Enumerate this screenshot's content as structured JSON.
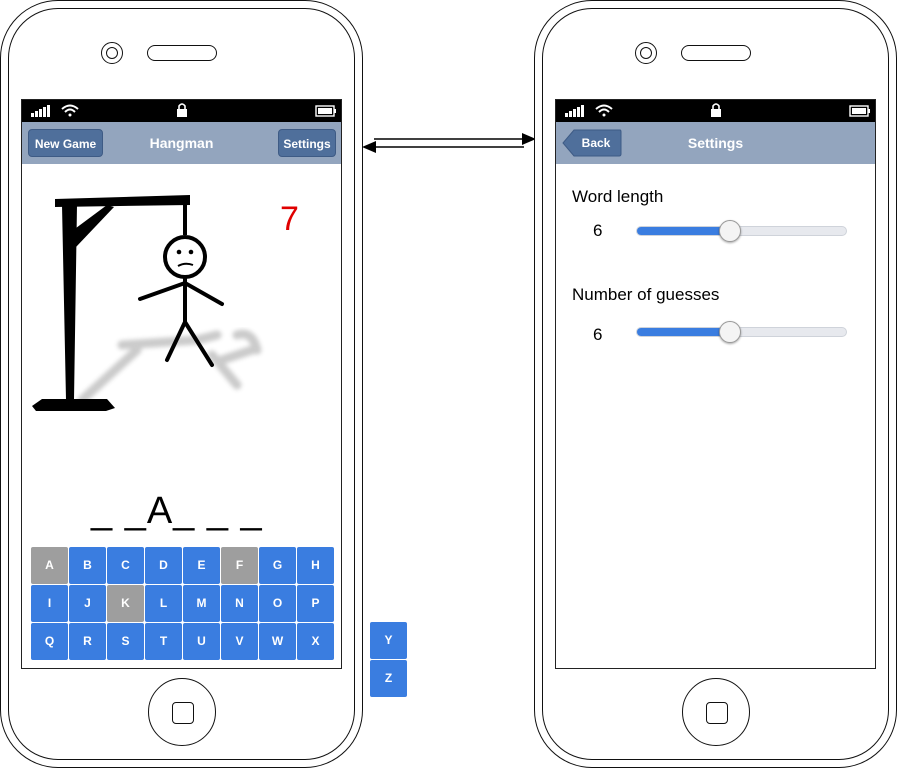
{
  "left_phone": {
    "nav": {
      "title": "Hangman",
      "new_game_label": "New Game",
      "settings_label": "Settings"
    },
    "guesses_remaining": "7",
    "word_display": "_ _A_ _ _",
    "keyboard": {
      "rows": [
        [
          "A",
          "B",
          "C",
          "D",
          "E",
          "F",
          "G",
          "H"
        ],
        [
          "I",
          "J",
          "K",
          "L",
          "M",
          "N",
          "O",
          "P"
        ],
        [
          "Q",
          "R",
          "S",
          "T",
          "U",
          "V",
          "W",
          "X"
        ]
      ],
      "overflow": [
        "Y",
        "Z"
      ],
      "used_letters": [
        "A",
        "F",
        "K"
      ]
    },
    "colors": {
      "nav_bar": "#93a5be",
      "nav_button": "#4f6f9b",
      "key": "#3a7de0",
      "key_used": "#9e9e9e",
      "counter": "#e00000"
    }
  },
  "right_phone": {
    "nav": {
      "title": "Settings",
      "back_label": "Back"
    },
    "word_length": {
      "label": "Word length",
      "value": "6",
      "fraction": 0.44
    },
    "number_of_guesses": {
      "label": "Number of guesses",
      "value": "6",
      "fraction": 0.44
    }
  },
  "flow_arrow": "bidirectional"
}
